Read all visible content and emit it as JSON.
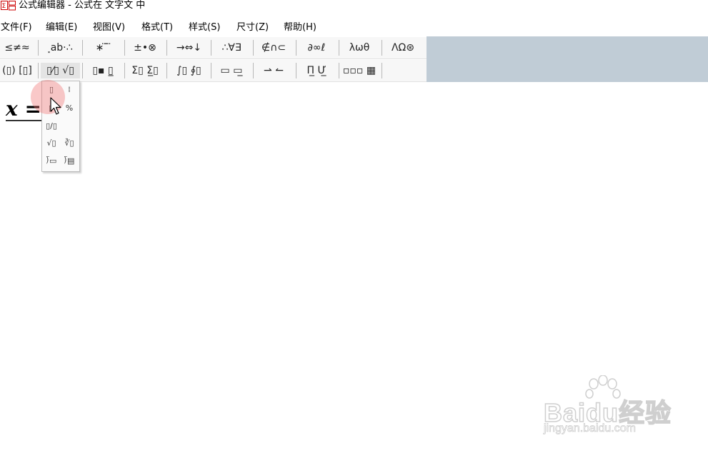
{
  "window": {
    "title": "公式编辑器 - 公式在 文字文 中"
  },
  "menu": {
    "items": [
      {
        "id": "file",
        "label": "文件(F)"
      },
      {
        "id": "edit",
        "label": "编辑(E)"
      },
      {
        "id": "view",
        "label": "视图(V)"
      },
      {
        "id": "format",
        "label": "格式(T)"
      },
      {
        "id": "style",
        "label": "样式(S)"
      },
      {
        "id": "size",
        "label": "尺寸(Z)"
      },
      {
        "id": "help",
        "label": "帮助(H)"
      }
    ]
  },
  "toolbar": {
    "row1": [
      {
        "name": "relations-palette",
        "label": "≤≠≈"
      },
      {
        "name": "spaces-ellipses-palette",
        "label": "⸼ab·∴"
      },
      {
        "name": "embellishments-palette",
        "label": "∗ ⃛ ⃛"
      },
      {
        "name": "operators-palette",
        "label": "±•⊗"
      },
      {
        "name": "arrows-palette",
        "label": "→⇔↓"
      },
      {
        "name": "logic-palette",
        "label": "∴∀∃"
      },
      {
        "name": "set-theory-palette",
        "label": "∉∩⊂"
      },
      {
        "name": "misc-symbols-palette",
        "label": "∂∞ℓ"
      },
      {
        "name": "greek-lower-palette",
        "label": "λωθ"
      },
      {
        "name": "greek-upper-palette",
        "label": "ΛΩ⊛"
      }
    ],
    "row2": [
      {
        "name": "fences-palette",
        "label": "(▯) [▯]"
      },
      {
        "name": "fraction-radical-palette",
        "label": "▯⁄▯ √▯"
      },
      {
        "name": "subscript-superscript-palette",
        "label": "▯▪ ▯̲"
      },
      {
        "name": "summation-palette",
        "label": "Σ▯ Σ̲▯"
      },
      {
        "name": "integral-palette",
        "label": "∫▯ ∮▯"
      },
      {
        "name": "underbar-overbar-palette",
        "label": "▭ ▭̲"
      },
      {
        "name": "labeled-arrows-palette",
        "label": "⇀ ↼"
      },
      {
        "name": "products-palette",
        "label": "Π̲ Ư̲"
      },
      {
        "name": "matrix-palette",
        "label": "▫▫▫ ▦"
      }
    ]
  },
  "equation": {
    "text": "x ="
  },
  "dropdown": {
    "items": [
      {
        "name": "full-size-fraction",
        "glyph": "▯"
      },
      {
        "name": "reduced-fraction",
        "glyph": "⁞"
      },
      {
        "name": "diagonal-fraction-full",
        "glyph": "▯⁄"
      },
      {
        "name": "slash-fraction",
        "glyph": "%"
      },
      {
        "name": "inline-slash-fraction",
        "glyph": "▯/▯"
      },
      {
        "name": "square-root",
        "glyph": "√▯"
      },
      {
        "name": "nth-root",
        "glyph": "∛▯"
      },
      {
        "name": "long-division",
        "glyph": "⟌▭"
      },
      {
        "name": "long-division-quotient",
        "glyph": "⟌▤"
      }
    ]
  },
  "watermark": {
    "logo": "Baidu经验",
    "url": "jingyan.baidu.com"
  },
  "colors": {
    "toolbar_background": "#c0ccd6",
    "click_highlight": "#f06e6e"
  }
}
